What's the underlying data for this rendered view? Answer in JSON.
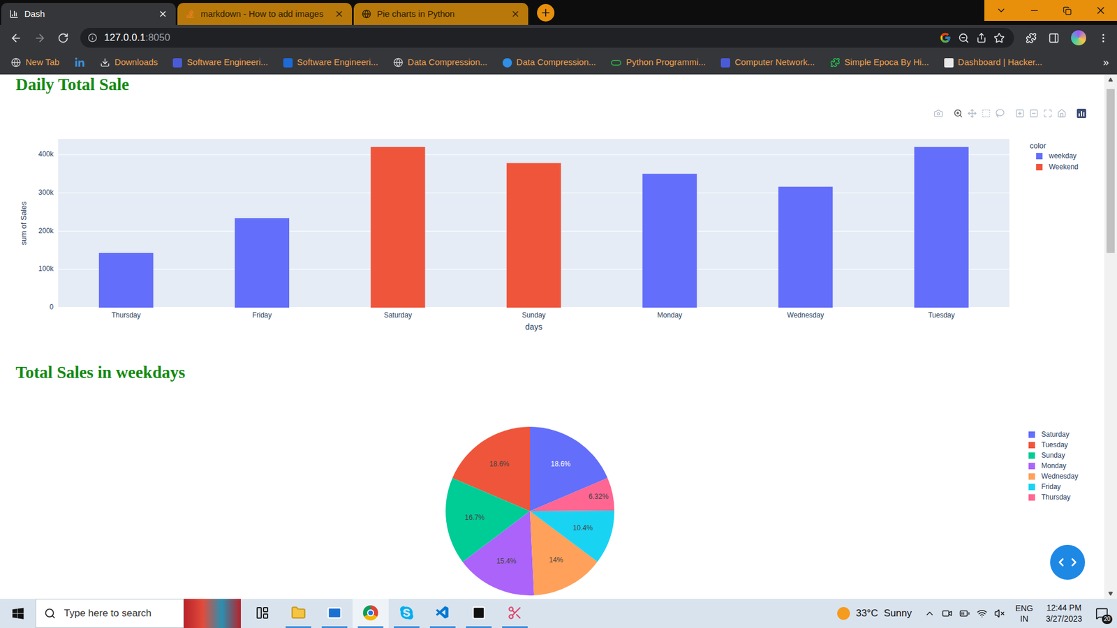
{
  "browser": {
    "tabs": [
      {
        "label": "Dash",
        "selected": true
      },
      {
        "label": "markdown - How to add images",
        "selected": false
      },
      {
        "label": "Pie charts in Python",
        "selected": false
      }
    ],
    "address": {
      "host": "127.0.0.1",
      "port": ":8050"
    },
    "bookmarks": [
      {
        "label": "New Tab"
      },
      {
        "label": null
      },
      {
        "label": "Downloads"
      },
      {
        "label": "Software Engineeri..."
      },
      {
        "label": "Software Engineeri..."
      },
      {
        "label": "Data Compression..."
      },
      {
        "label": "Data Compression..."
      },
      {
        "label": "Python Programmi..."
      },
      {
        "label": "Computer Network..."
      },
      {
        "label": "Simple Epoca By Hi..."
      },
      {
        "label": "Dashboard | Hacker..."
      }
    ],
    "bookmarks_overflow": "»"
  },
  "page": {
    "bar_chart": {
      "title": "Daily Total Sale",
      "x_title": "days",
      "y_title": "sum of Sales",
      "legend_title": "color",
      "categories": [
        "Thursday",
        "Friday",
        "Saturday",
        "Sunday",
        "Monday",
        "Wednesday",
        "Tuesday"
      ],
      "y_ticks": [
        {
          "label": "0",
          "value": 0
        },
        {
          "label": "100k",
          "value": 100000
        },
        {
          "label": "200k",
          "value": 200000
        },
        {
          "label": "300k",
          "value": 300000
        },
        {
          "label": "400k",
          "value": 400000
        }
      ],
      "series": [
        {
          "name": "weekday",
          "color": "#636efa",
          "values": [
            143000,
            234000,
            null,
            null,
            350000,
            316000,
            420000
          ]
        },
        {
          "name": "Weekend",
          "color": "#ef553b",
          "values": [
            null,
            null,
            420000,
            378000,
            null,
            null,
            null
          ]
        }
      ],
      "modebar": [
        {
          "selected": false
        },
        {
          "selected": true
        },
        {
          "selected": false
        },
        {
          "selected": false
        },
        {
          "selected": false
        },
        {
          "selected": false
        },
        {
          "selected": false
        },
        {
          "selected": false
        },
        {
          "selected": false
        },
        {
          "selected": false
        }
      ]
    },
    "pie_chart": {
      "title": "Total Sales in weekdays",
      "slices": [
        {
          "label": "Saturday",
          "value": 420000,
          "percent": "18.6%",
          "color": "#636efa"
        },
        {
          "label": "Tuesday",
          "value": 420000,
          "percent": "18.6%",
          "color": "#ef553b"
        },
        {
          "label": "Sunday",
          "value": 378000,
          "percent": "16.7%",
          "color": "#00cc96"
        },
        {
          "label": "Monday",
          "value": 350000,
          "percent": "15.4%",
          "color": "#ab63fa"
        },
        {
          "label": "Wednesday",
          "value": 316000,
          "percent": "14%",
          "color": "#ffa15a"
        },
        {
          "label": "Friday",
          "value": 234000,
          "percent": "10.4%",
          "color": "#19d3f3"
        },
        {
          "label": "Thursday",
          "value": 143000,
          "percent": "6.32%",
          "color": "#ff6692"
        }
      ]
    }
  },
  "taskbar": {
    "search_placeholder": "Type here to search",
    "apps": [
      {
        "running": false,
        "active": false
      },
      {
        "running": true,
        "active": false
      },
      {
        "running": true,
        "active": false
      },
      {
        "running": true,
        "active": true
      },
      {
        "running": true,
        "active": false
      },
      {
        "running": true,
        "active": false
      },
      {
        "running": true,
        "active": false
      },
      {
        "running": true,
        "active": false
      }
    ],
    "weather": {
      "temperature": "33°C",
      "condition": "Sunny"
    },
    "language": [
      "ENG",
      "IN"
    ],
    "time": "12:44 PM",
    "date": "3/27/2023",
    "notifications": "20"
  }
}
